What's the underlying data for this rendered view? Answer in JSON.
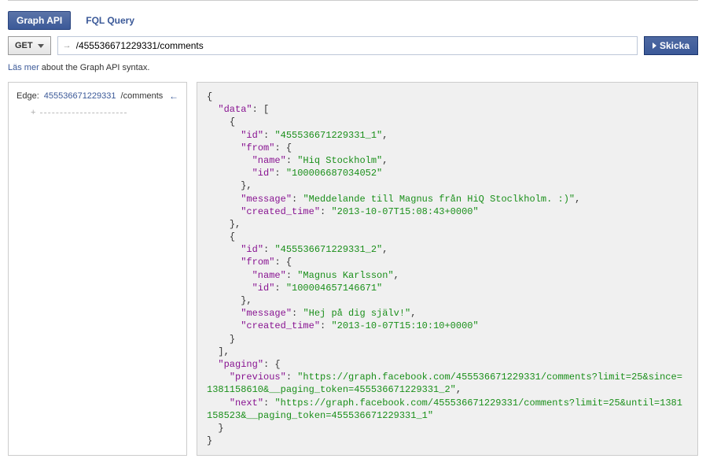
{
  "tabs": {
    "graph_api": "Graph API",
    "fql_query": "FQL Query"
  },
  "query": {
    "method": "GET",
    "arrow": "→",
    "path": "/455536671229331/comments",
    "submit": "Skicka"
  },
  "help": {
    "link": "Läs mer",
    "rest": " about the Graph API syntax."
  },
  "sidebar": {
    "edge_label": "Edge:",
    "node_id": "455536671229331",
    "connection": "/comments",
    "back_arrow": "←",
    "add_plus": "+"
  },
  "response": {
    "data": [
      {
        "id": "455536671229331_1",
        "from": {
          "name": "Hiq Stockholm",
          "id": "100006687034052"
        },
        "message": "Meddelande till Magnus från HiQ Stoclkholm. :)",
        "created_time": "2013-10-07T15:08:43+0000"
      },
      {
        "id": "455536671229331_2",
        "from": {
          "name": "Magnus Karlsson",
          "id": "100004657146671"
        },
        "message": "Hej på dig själv!",
        "created_time": "2013-10-07T15:10:10+0000"
      }
    ],
    "paging": {
      "previous": "https://graph.facebook.com/455536671229331/comments?limit=25&since=1381158610&__paging_token=455536671229331_2",
      "next": "https://graph.facebook.com/455536671229331/comments?limit=25&until=1381158523&__paging_token=455536671229331_1"
    }
  }
}
